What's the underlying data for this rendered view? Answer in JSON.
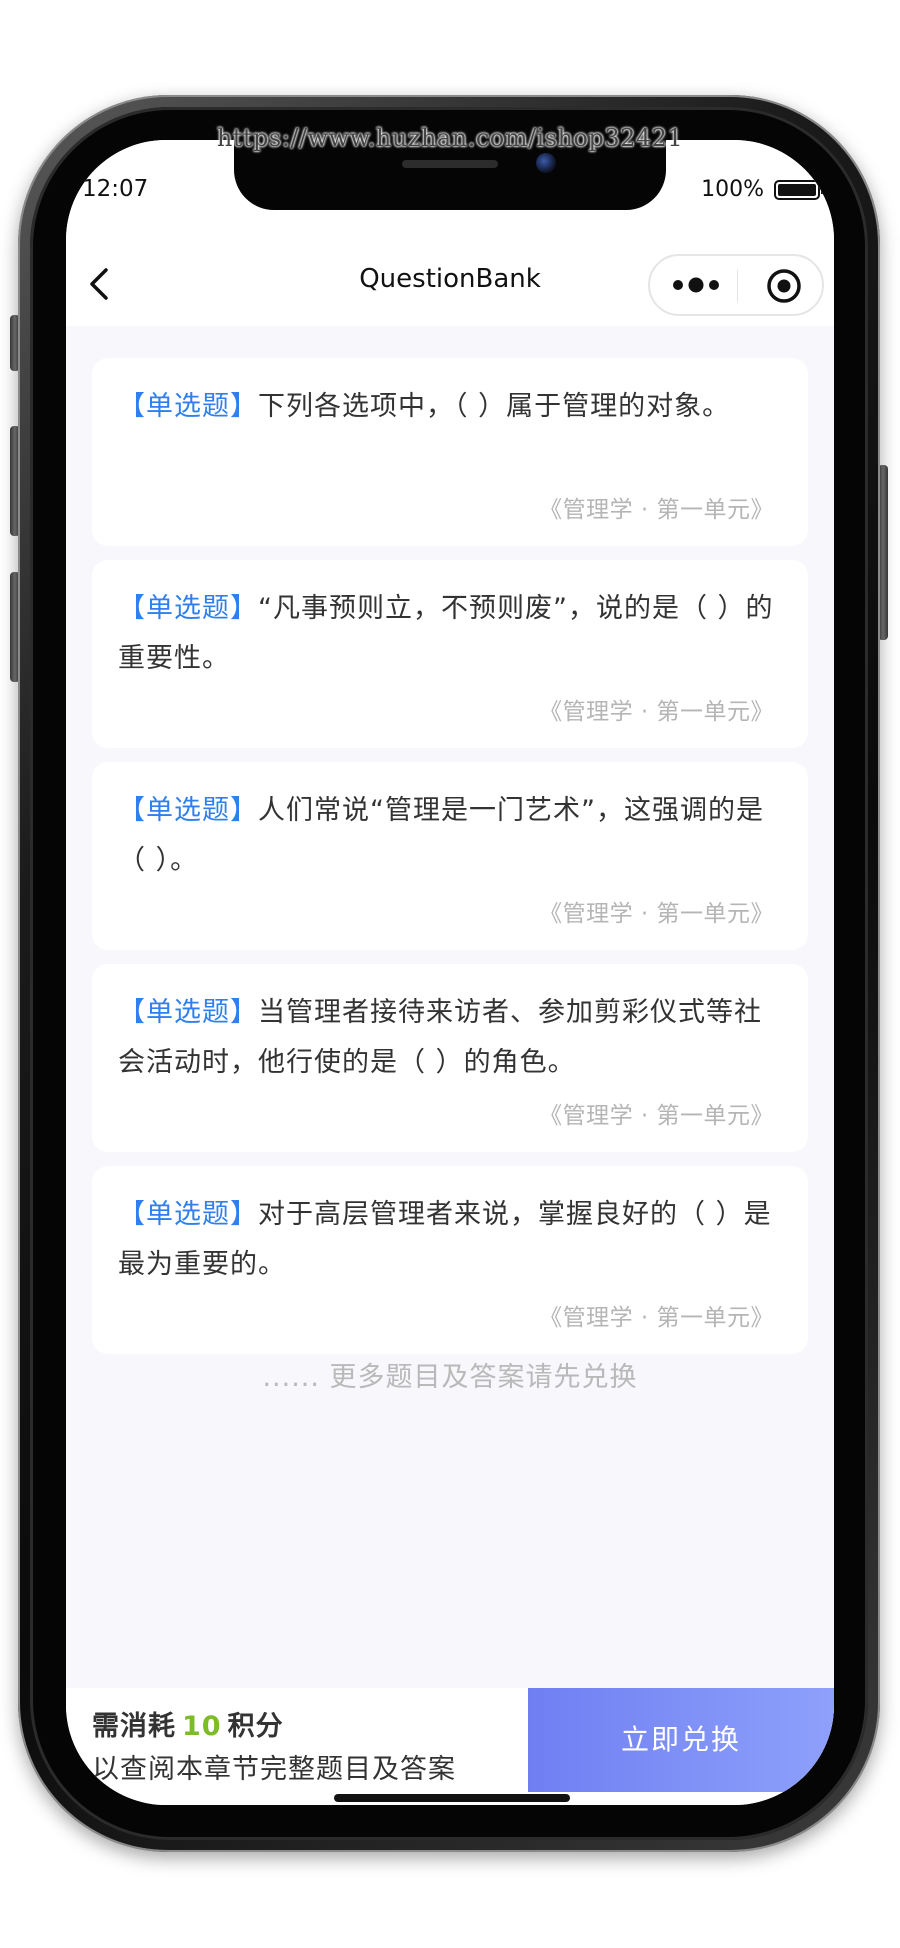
{
  "watermark": "https://www.huzhan.com/ishop32421",
  "status_bar": {
    "time": "12:07",
    "battery_text": "100%",
    "battery_level": 1.0
  },
  "nav": {
    "title": "QuestionBank",
    "back_icon": "chevron-left-icon",
    "more_icon": "more-dots-icon",
    "close_icon": "target-circle-icon"
  },
  "questions": [
    {
      "type": "【单选题】",
      "text": "下列各选项中，（ ）属于管理的对象。",
      "source": "《管理学 · 第一单元》"
    },
    {
      "type": "【单选题】",
      "text": "“凡事预则立，不预则废”，说的是（ ）的重要性。",
      "source": "《管理学 · 第一单元》"
    },
    {
      "type": "【单选题】",
      "text": "人们常说“管理是一门艺术”，这强调的是（ ）。",
      "source": "《管理学 · 第一单元》"
    },
    {
      "type": "【单选题】",
      "text": "当管理者接待来访者、参加剪彩仪式等社会活动时，他行使的是（ ）的角色。",
      "source": "《管理学 · 第一单元》"
    },
    {
      "type": "【单选题】",
      "text": "对于高层管理者来说，掌握良好的（ ）是最为重要的。",
      "source": "《管理学 · 第一单元》"
    }
  ],
  "more_hint": "...... 更多题目及答案请先兑换",
  "bottom": {
    "cost_prefix": "需消耗",
    "cost_points": "10",
    "cost_suffix": "积分",
    "cost_desc": "以查阅本章节完整题目及答案",
    "redeem_label": "立即兑换"
  },
  "colors": {
    "accent_blue": "#2f7ff0",
    "points_green": "#7cbb2a",
    "button_gradient_start": "#6f7ff2",
    "button_gradient_end": "#8ea0fb",
    "page_bg": "#f7f7fc"
  }
}
